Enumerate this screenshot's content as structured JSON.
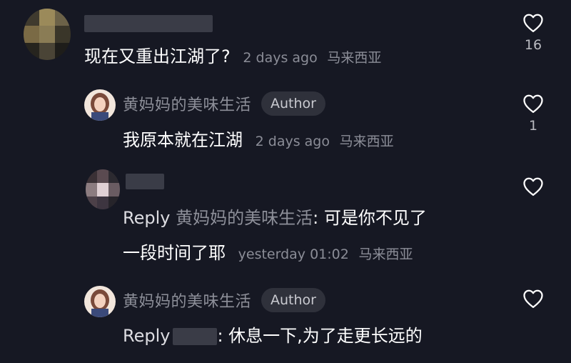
{
  "comments": [
    {
      "text": "现在又重出江湖了?",
      "time": "2 days ago",
      "location": "马来西亚",
      "likes": "16"
    },
    {
      "author": "黄妈妈的美味生活",
      "badge": "Author",
      "text": "我原本就在江湖",
      "time": "2 days ago",
      "location": "马来西亚",
      "likes": "1"
    },
    {
      "reply_label": "Reply",
      "reply_to": "黄妈妈的美味生活",
      "text_line1": ": 可是你不见了",
      "text_line2": "一段时间了耶",
      "time": "yesterday 01:02",
      "location": "马来西亚"
    },
    {
      "author": "黄妈妈的美味生活",
      "badge": "Author",
      "reply_label": "Reply",
      "text": ": 休息一下,为了走更长远的"
    }
  ],
  "icons": {
    "like": "heart-outline-icon"
  },
  "colors": {
    "background": "#161823",
    "secondary_text": "#8b8d97",
    "badge_bg": "#2f313b"
  }
}
